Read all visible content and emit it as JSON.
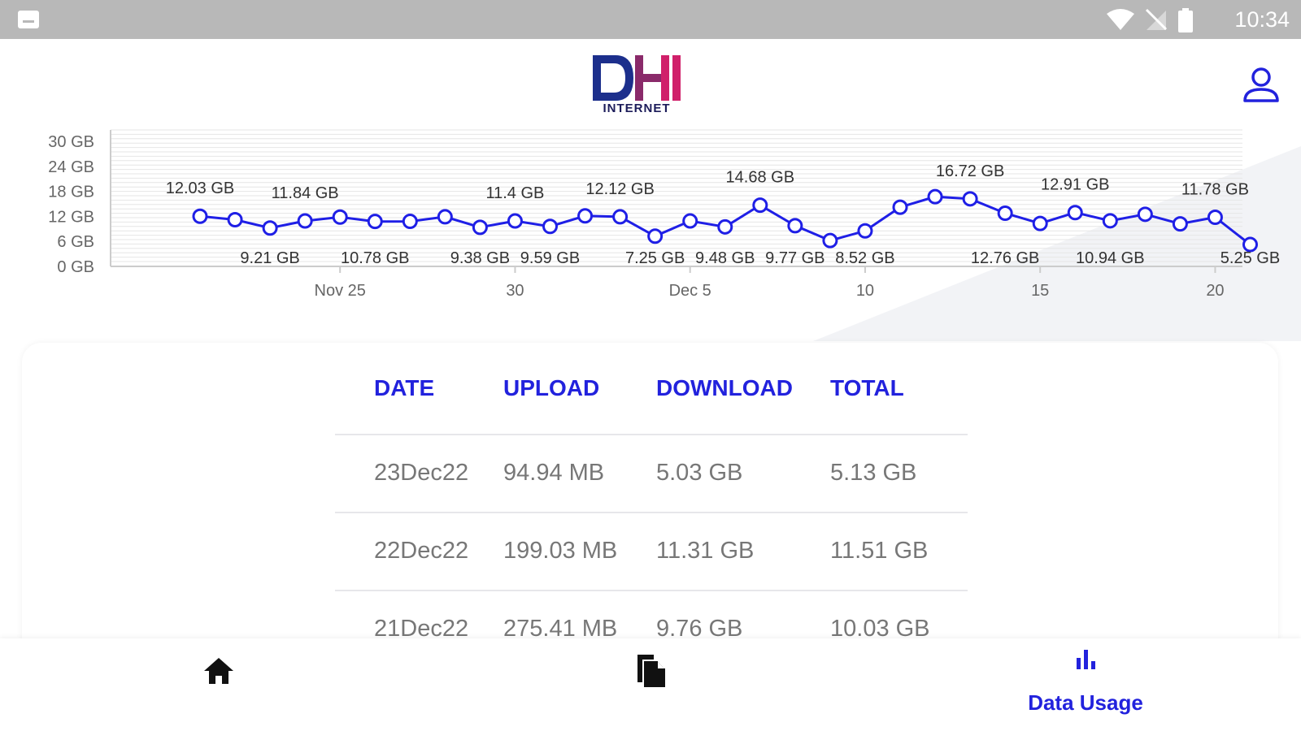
{
  "status_bar": {
    "time": "10:34"
  },
  "header": {
    "logo_text": "DHI",
    "logo_subtext": "INTERNET"
  },
  "colors": {
    "accent": "#2222dd",
    "line": "#1f1fe6",
    "text_muted": "#777777"
  },
  "icons": {
    "notification": "image-icon",
    "wifi": "wifi-icon",
    "signal": "no-signal-icon",
    "battery": "battery-icon",
    "account": "account-icon",
    "home": "home-icon",
    "documents": "documents-icon",
    "usage": "bar-chart-icon"
  },
  "chart_data": {
    "type": "line",
    "yticks": [
      "0 GB",
      "6 GB",
      "12 GB",
      "18 GB",
      "24 GB",
      "30 GB"
    ],
    "ylim": [
      0,
      30
    ],
    "xticks": [
      {
        "label": "Nov 25",
        "day": 4
      },
      {
        "label": "30",
        "day": 9
      },
      {
        "label": "Dec 5",
        "day": 14
      },
      {
        "label": "10",
        "day": 19
      },
      {
        "label": "15",
        "day": 24
      },
      {
        "label": "20",
        "day": 29
      }
    ],
    "grid": true,
    "series": [
      {
        "values": [
          12.03,
          11.2,
          9.21,
          10.9,
          11.84,
          10.78,
          10.8,
          11.9,
          9.38,
          10.9,
          9.59,
          12.12,
          11.9,
          7.25,
          10.9,
          9.48,
          14.68,
          9.77,
          6.2,
          8.52,
          14.2,
          16.72,
          16.2,
          12.76,
          10.3,
          12.91,
          10.94,
          12.5,
          10.2,
          11.78,
          5.25
        ],
        "labels": [
          {
            "i": 0,
            "text": "12.03 GB",
            "pos": "above"
          },
          {
            "i": 2,
            "text": "9.21 GB",
            "pos": "below"
          },
          {
            "i": 3,
            "text": "11.84 GB",
            "pos": "above"
          },
          {
            "i": 5,
            "text": "10.78 GB",
            "pos": "below"
          },
          {
            "i": 8,
            "text": "9.38 GB",
            "pos": "below"
          },
          {
            "i": 9,
            "text": "11.4 GB",
            "pos": "above"
          },
          {
            "i": 10,
            "text": "9.59 GB",
            "pos": "below"
          },
          {
            "i": 12,
            "text": "12.12 GB",
            "pos": "above"
          },
          {
            "i": 13,
            "text": "7.25 GB",
            "pos": "below"
          },
          {
            "i": 15,
            "text": "9.48 GB",
            "pos": "below"
          },
          {
            "i": 16,
            "text": "14.68 GB",
            "pos": "above"
          },
          {
            "i": 17,
            "text": "9.77 GB",
            "pos": "below"
          },
          {
            "i": 19,
            "text": "8.52 GB",
            "pos": "below"
          },
          {
            "i": 22,
            "text": "16.72 GB",
            "pos": "above"
          },
          {
            "i": 23,
            "text": "12.76 GB",
            "pos": "below"
          },
          {
            "i": 25,
            "text": "12.91 GB",
            "pos": "above"
          },
          {
            "i": 26,
            "text": "10.94 GB",
            "pos": "below"
          },
          {
            "i": 29,
            "text": "11.78 GB",
            "pos": "above"
          },
          {
            "i": 30,
            "text": "5.25 GB",
            "pos": "below"
          }
        ]
      }
    ]
  },
  "table": {
    "headers": [
      "DATE",
      "UPLOAD",
      "DOWNLOAD",
      "TOTAL"
    ],
    "rows": [
      [
        "23Dec22",
        "94.94 MB",
        "5.03 GB",
        "5.13 GB"
      ],
      [
        "22Dec22",
        "199.03 MB",
        "11.31 GB",
        "11.51 GB"
      ],
      [
        "21Dec22",
        "275.41 MB",
        "9.76 GB",
        "10.03 GB"
      ]
    ]
  },
  "bottom_nav": {
    "items": [
      {
        "label": ""
      },
      {
        "label": ""
      },
      {
        "label": "Data Usage",
        "active": true
      }
    ]
  }
}
